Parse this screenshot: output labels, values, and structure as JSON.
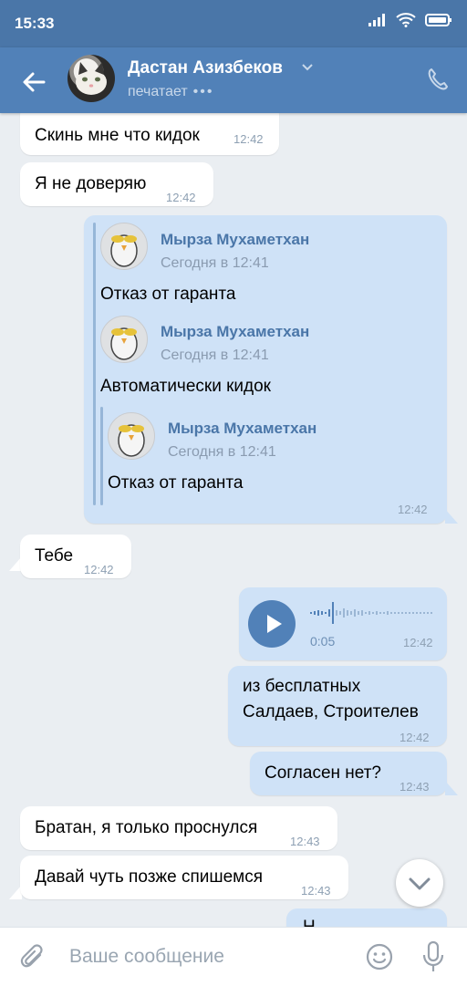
{
  "status": {
    "time": "15:33"
  },
  "header": {
    "name": "Дастан Азизбеков",
    "status_text": "печатает",
    "typing_dots": "•••"
  },
  "messages": {
    "m1": {
      "text": "Скинь мне что кидок",
      "time": "12:42"
    },
    "m2": {
      "text": "Я не доверяю",
      "time": "12:42"
    },
    "fwd": {
      "time": "12:42",
      "f1": {
        "author": "Мырза Мухаметхан",
        "date": "Сегодня в 12:41",
        "text": "Отказ от гаранта"
      },
      "f2": {
        "author": "Мырза Мухаметхан",
        "date": "Сегодня в 12:41",
        "text": "Автоматически кидок"
      },
      "f3": {
        "author": "Мырза Мухаметхан",
        "date": "Сегодня в 12:41",
        "text": "Отказ от гаранта"
      }
    },
    "m3": {
      "text": "Тебе",
      "time": "12:42"
    },
    "voice": {
      "duration": "0:05",
      "time": "12:42"
    },
    "m4": {
      "line1": "из бесплатных",
      "line2": "Салдаев, Строителев",
      "time": "12:42"
    },
    "m5": {
      "text": "Согласен нет?",
      "time": "12:43"
    },
    "m6": {
      "text": "Братан, я только проснулся",
      "time": "12:43"
    },
    "m7": {
      "text": "Давай чуть позже спишемся",
      "time": "12:43"
    }
  },
  "composer": {
    "placeholder": "Ваше сообщение"
  },
  "colors": {
    "header": "#5181b8",
    "statusbar": "#4a76a8",
    "outgoing": "#cfe2f7",
    "incoming": "#ffffff",
    "background": "#eaeef2"
  },
  "icons": [
    "back-arrow-icon",
    "chevron-down-icon",
    "phone-icon",
    "play-icon",
    "scroll-down-icon",
    "attach-icon",
    "emoji-icon",
    "microphone-icon",
    "signal-icon",
    "wifi-icon",
    "battery-icon"
  ]
}
